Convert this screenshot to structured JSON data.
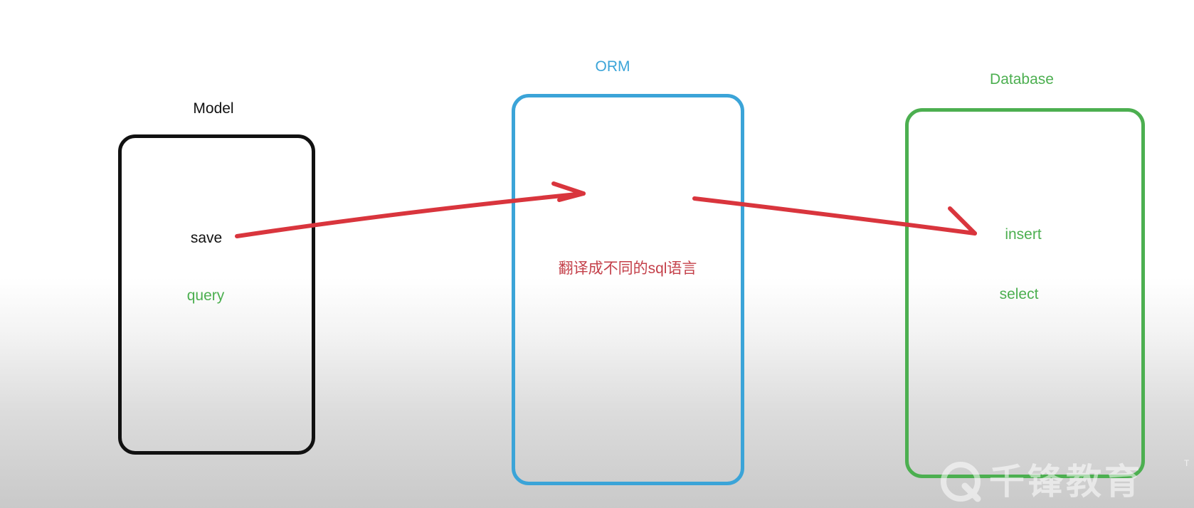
{
  "model": {
    "title": "Model",
    "items": [
      "save",
      "query"
    ]
  },
  "orm": {
    "title": "ORM",
    "note": "翻译成不同的sql语言"
  },
  "database": {
    "title": "Database",
    "items": [
      "insert",
      "select"
    ]
  },
  "watermark": {
    "text": "千锋教育",
    "mark": "T"
  },
  "colors": {
    "model": "#111111",
    "orm": "#3ba4d8",
    "database": "#4caf50",
    "arrow": "#d9353d",
    "orm_note": "#c4404a",
    "green_text": "#4caf50"
  },
  "icons": [
    "arrow-save-to-orm",
    "arrow-orm-to-insert",
    "qianfeng-logo-icon"
  ]
}
